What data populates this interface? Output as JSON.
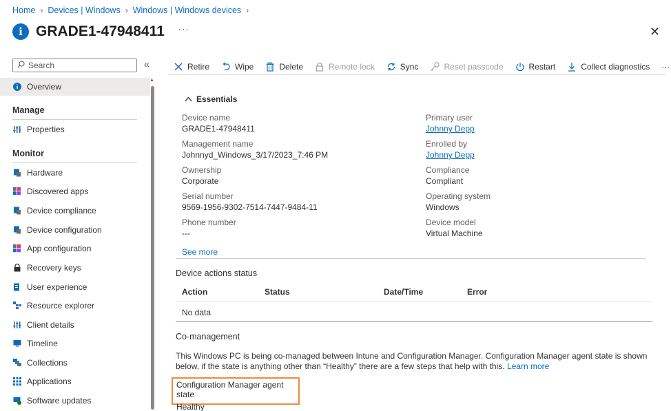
{
  "breadcrumb": [
    "Home",
    "Devices | Windows",
    "Windows | Windows devices"
  ],
  "header": {
    "title": "GRADE1-47948411",
    "more": "···"
  },
  "sidebar": {
    "search_placeholder": "Search",
    "collapse": "«",
    "overview": "Overview",
    "manage_heading": "Manage",
    "properties": "Properties",
    "monitor_heading": "Monitor",
    "monitor_items": [
      "Hardware",
      "Discovered apps",
      "Device compliance",
      "Device configuration",
      "App configuration",
      "Recovery keys",
      "User experience",
      "Resource explorer",
      "Client details",
      "Timeline",
      "Collections",
      "Applications",
      "Software updates"
    ]
  },
  "toolbar": {
    "retire": "Retire",
    "wipe": "Wipe",
    "delete": "Delete",
    "remote_lock": "Remote lock",
    "sync": "Sync",
    "reset_passcode": "Reset passcode",
    "restart": "Restart",
    "collect_diagnostics": "Collect diagnostics",
    "more": "···"
  },
  "essentials": {
    "heading": "Essentials",
    "left": [
      {
        "label": "Device name",
        "value": "GRADE1-47948411"
      },
      {
        "label": "Management name",
        "value": "Johnnyd_Windows_3/17/2023_7:46 PM"
      },
      {
        "label": "Ownership",
        "value": "Corporate"
      },
      {
        "label": "Serial number",
        "value": "9569-1956-9302-7514-7447-9484-11"
      },
      {
        "label": "Phone number",
        "value": "---"
      }
    ],
    "right": [
      {
        "label": "Primary user",
        "value": "Johnny Depp"
      },
      {
        "label": "Enrolled by",
        "value": "Johnny Depp"
      },
      {
        "label": "Compliance",
        "value": "Compliant"
      },
      {
        "label": "Operating system",
        "value": "Windows"
      },
      {
        "label": "Device model",
        "value": "Virtual Machine"
      }
    ],
    "see_more": "See more"
  },
  "device_actions": {
    "title": "Device actions status",
    "columns": [
      "Action",
      "Status",
      "Date/Time",
      "Error"
    ],
    "empty": "No data"
  },
  "comanagement": {
    "title": "Co-management",
    "text": "This Windows PC is being co-managed between Intune and Configuration Manager. Configuration Manager agent state is shown below, if the state is anything other than “Healthy” there are a few steps that help with this.",
    "learn_more": "Learn more",
    "agent_label": "Configuration Manager agent state",
    "agent_value": "Healthy"
  },
  "colors": {
    "accent": "#0f6cbd",
    "highlight_border": "#f08a3c"
  }
}
